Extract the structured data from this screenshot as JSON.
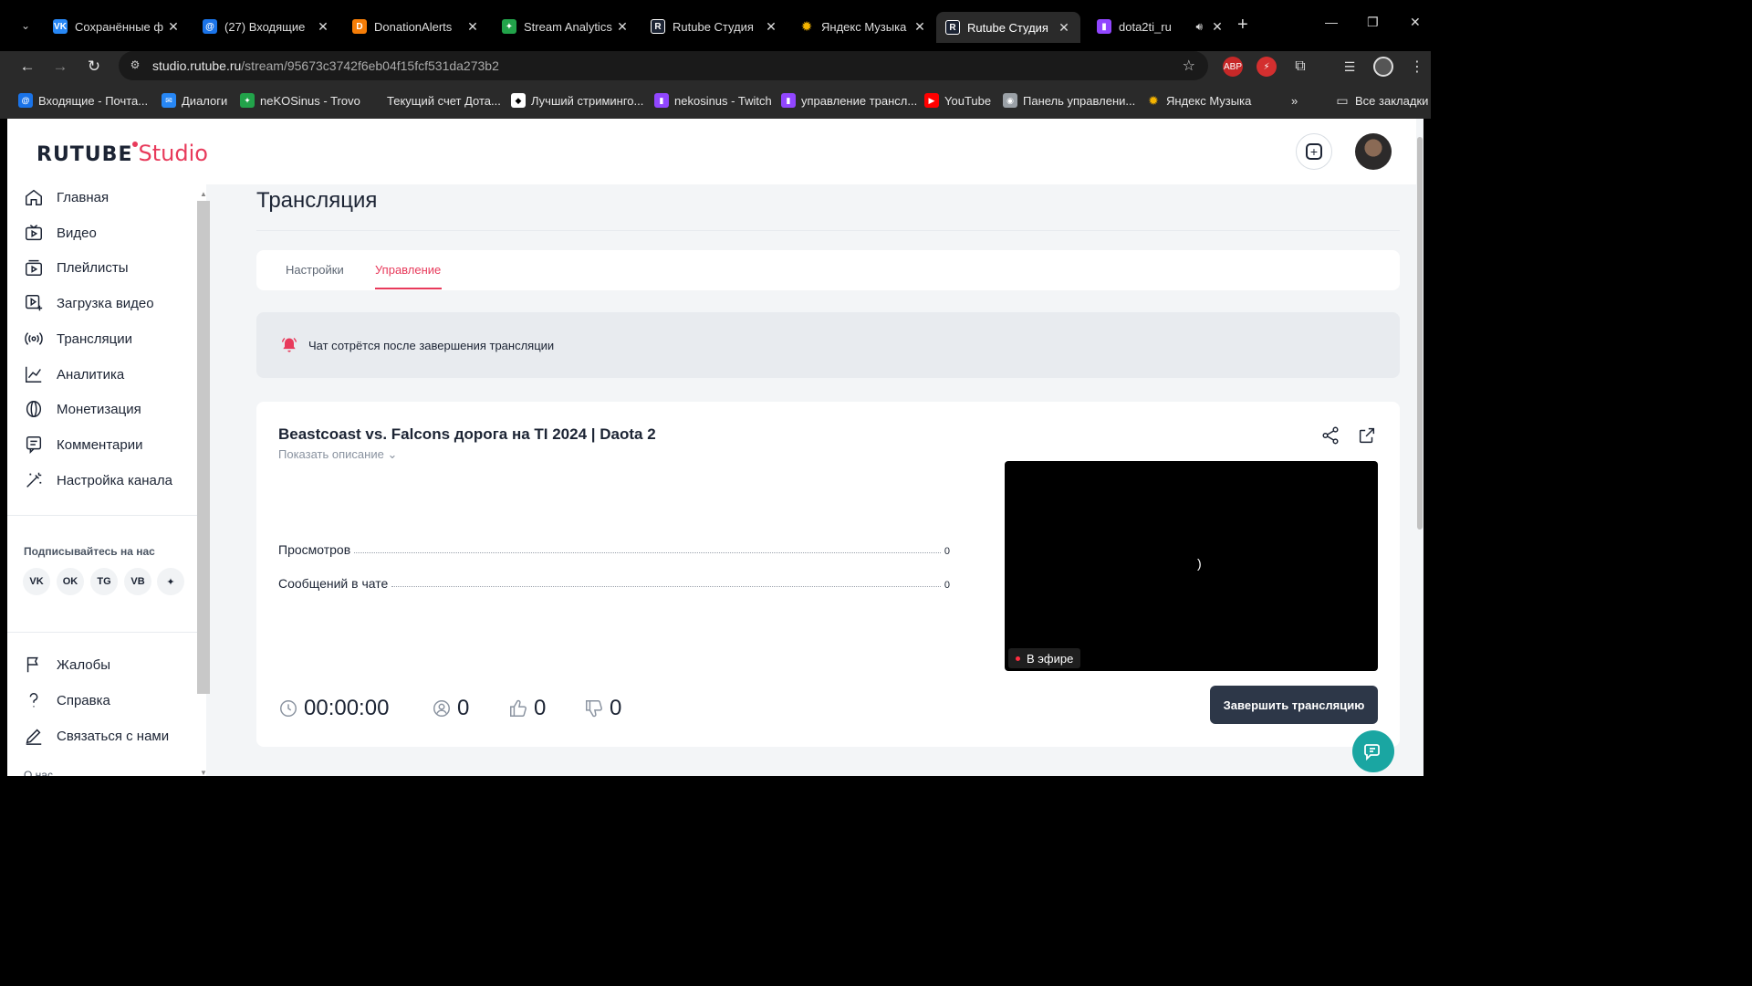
{
  "browser": {
    "tabs": [
      {
        "label": "Сохранённые ф",
        "fav": "VK",
        "fav_color": "#2787f5"
      },
      {
        "label": "(27) Входящие",
        "fav": "@",
        "fav_color": "#1a73e8"
      },
      {
        "label": "DonationAlerts",
        "fav": "D",
        "fav_color": "#f57d07"
      },
      {
        "label": "Stream Analytics",
        "fav": "✦",
        "fav_color": "#22a34a"
      },
      {
        "label": "Rutube Студия",
        "fav": "R",
        "fav_color": "#1c2434"
      },
      {
        "label": "Яндекс Музыка",
        "fav": "✹",
        "fav_color": "#f5b400"
      },
      {
        "label": "Rutube Студия",
        "fav": "R",
        "fav_color": "#1c2434"
      },
      {
        "label": "dota2ti_ru",
        "fav": "▮",
        "fav_color": "#9146ff"
      }
    ],
    "url_host": "studio.rutube.ru",
    "url_path": "/stream/95673c3742f6eb04f15fcf531da273b2",
    "bookmarks": [
      {
        "label": "Входящие - Почта...",
        "color": "#1a73e8",
        "glyph": "@"
      },
      {
        "label": "Диалоги",
        "color": "#2787f5",
        "glyph": "✉"
      },
      {
        "label": "neKOSinus - Trovo",
        "color": "#22a34a",
        "glyph": "✦"
      },
      {
        "label": "Текущий счет Дота...",
        "color": "#2a2a2a",
        "glyph": ""
      },
      {
        "label": "Лучший стриминго...",
        "color": "#ffffff",
        "glyph": "◆"
      },
      {
        "label": "nekosinus - Twitch",
        "color": "#9146ff",
        "glyph": "▮"
      },
      {
        "label": "управление трансл...",
        "color": "#9146ff",
        "glyph": "▮"
      },
      {
        "label": "YouTube",
        "color": "#ff0000",
        "glyph": "▶"
      },
      {
        "label": "Панель управлени...",
        "color": "#9aa0a6",
        "glyph": "◉"
      },
      {
        "label": "Яндекс Музыка",
        "color": "#f5b400",
        "glyph": "✹"
      }
    ],
    "all_bookmarks": "Все закладки"
  },
  "logo": {
    "part1": "RUTUBE",
    "part2": "Studio"
  },
  "sidebar": {
    "items": [
      {
        "label": "Главная",
        "icon": "home-icon"
      },
      {
        "label": "Видео",
        "icon": "video-icon"
      },
      {
        "label": "Плейлисты",
        "icon": "playlist-icon"
      },
      {
        "label": "Загрузка видео",
        "icon": "upload-icon"
      },
      {
        "label": "Трансляции",
        "icon": "broadcast-icon"
      },
      {
        "label": "Аналитика",
        "icon": "analytics-icon"
      },
      {
        "label": "Монетизация",
        "icon": "coin-icon"
      },
      {
        "label": "Комментарии",
        "icon": "comments-icon"
      },
      {
        "label": "Настройка канала",
        "icon": "wand-icon"
      }
    ],
    "subscribe_caption": "Подписывайтесь на нас",
    "socials": [
      "VK",
      "OK",
      "TG",
      "VB",
      "✦"
    ],
    "bottom_items": [
      {
        "label": "Жалобы",
        "icon": "flag-icon"
      },
      {
        "label": "Справка",
        "icon": "help-icon"
      },
      {
        "label": "Связаться с нами",
        "icon": "pen-icon"
      }
    ],
    "about": "О нас"
  },
  "main": {
    "title": "Трансляция",
    "tabs": [
      {
        "label": "Настройки",
        "active": false
      },
      {
        "label": "Управление",
        "active": true
      }
    ],
    "notice": "Чат сотрётся после завершения трансляции",
    "stream": {
      "title": "Beastcoast vs. Falcons дорога на TI 2024 | Daota 2",
      "show_description": "Показать описание",
      "stats": [
        {
          "label": "Просмотров",
          "value": "0"
        },
        {
          "label": "Сообщений в чате",
          "value": "0"
        }
      ],
      "live_badge": "В эфире",
      "player_glyph": ")",
      "timer": "00:00:00",
      "viewers": "0",
      "likes": "0",
      "dislikes": "0",
      "end_button": "Завершить трансляцию"
    }
  },
  "colors": {
    "accent": "#e83a5b",
    "dark": "#1c2434",
    "button": "#2d3748",
    "help_fab": "#1aa6a2"
  }
}
